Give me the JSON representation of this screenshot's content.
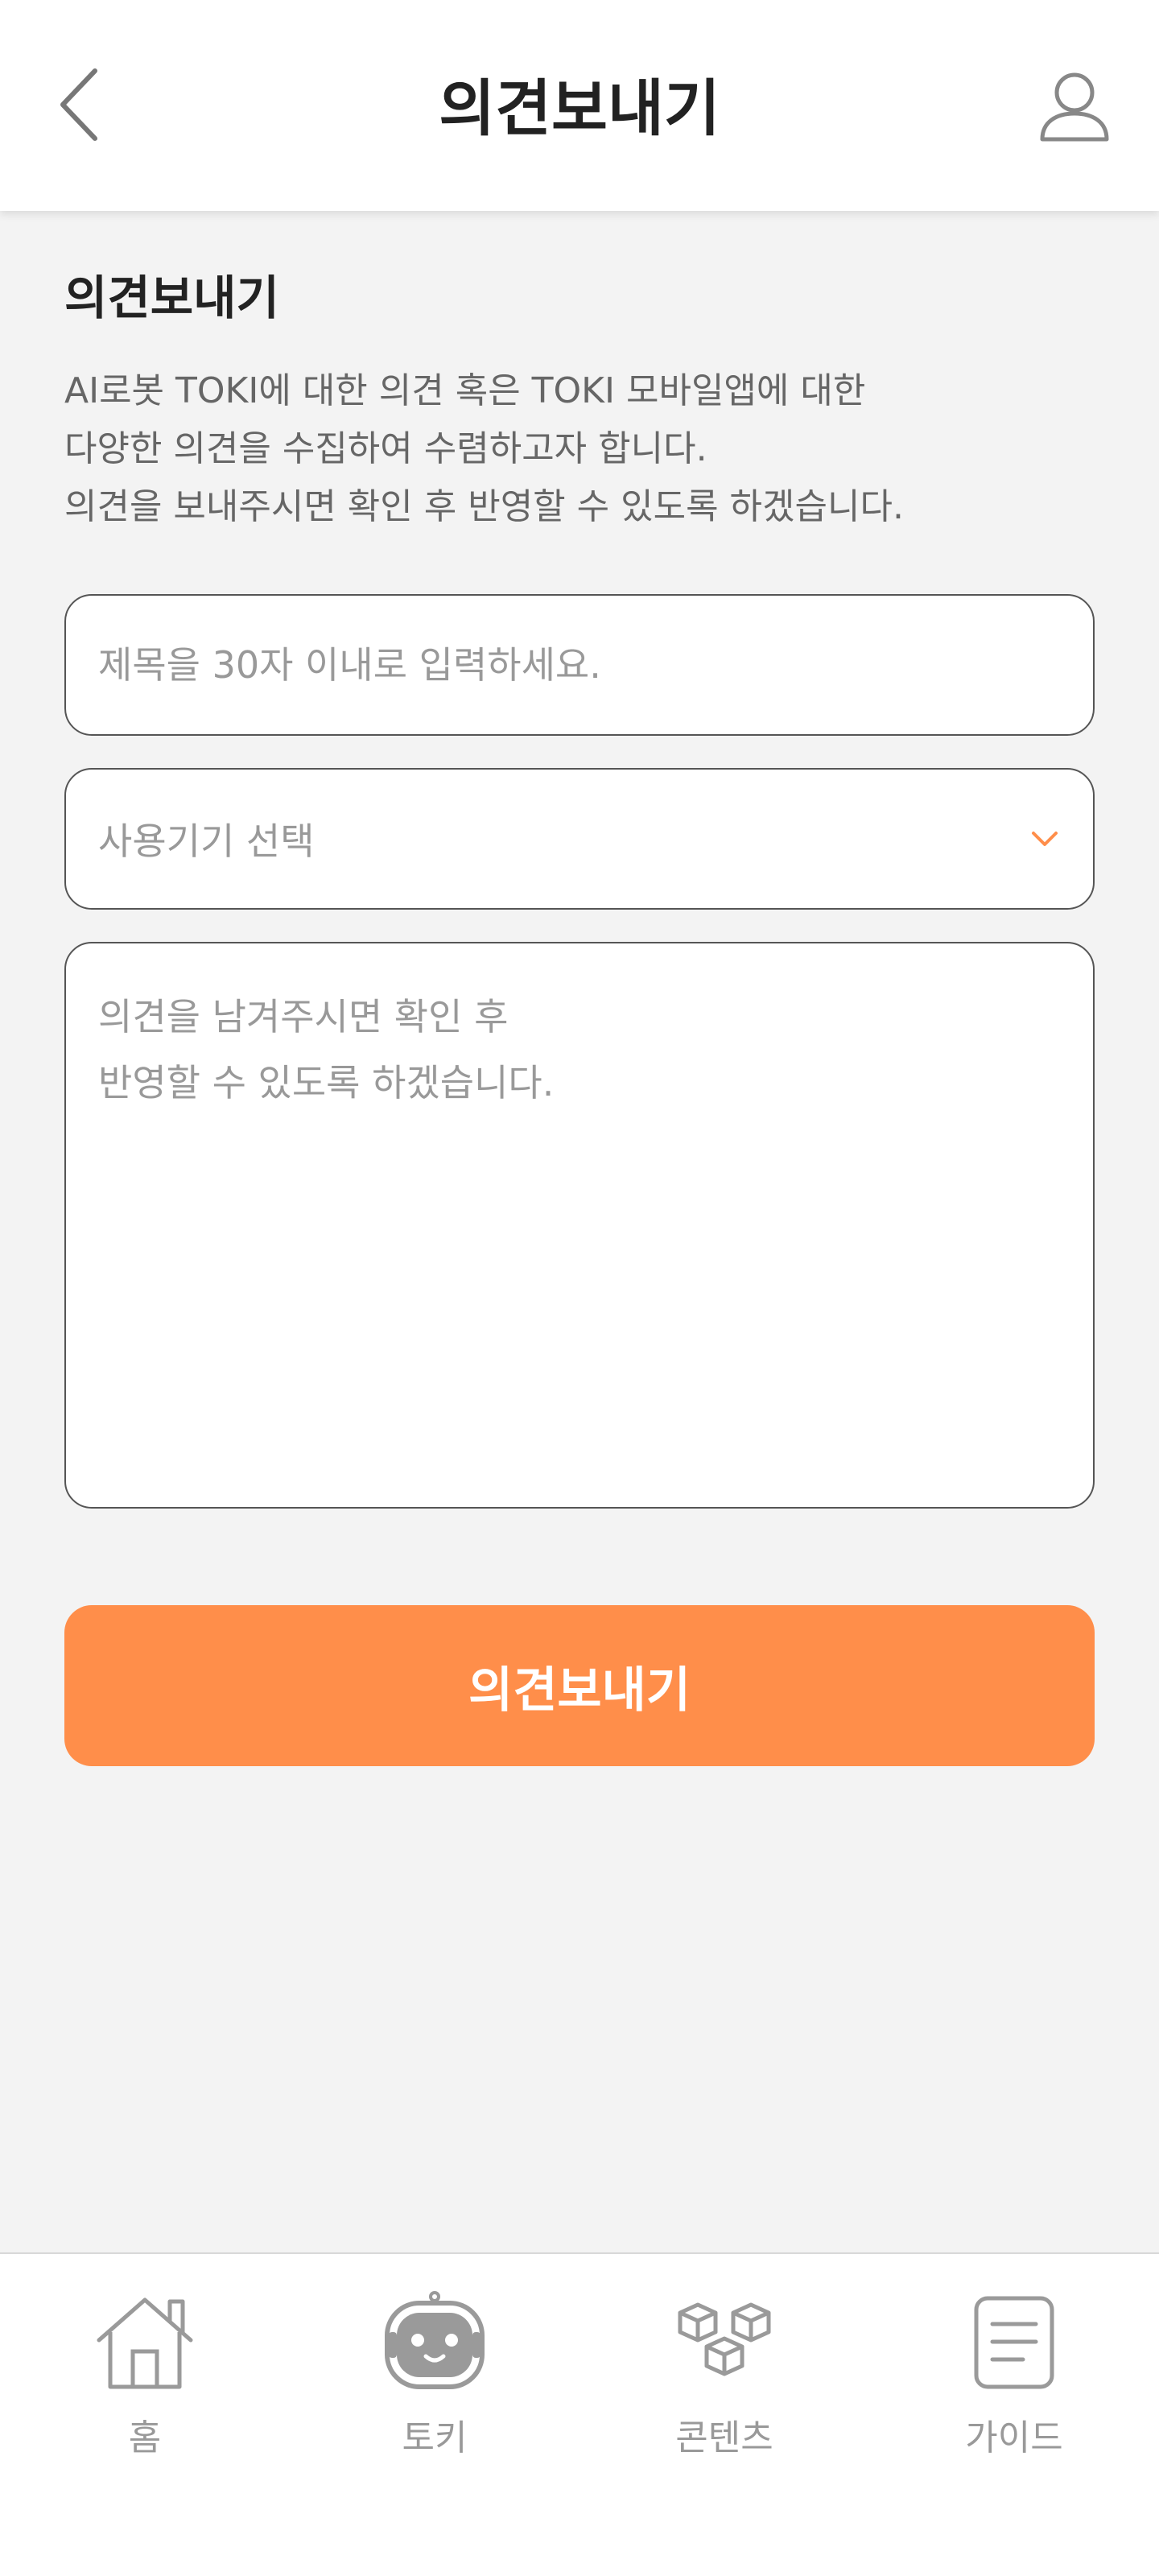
{
  "header": {
    "title": "의견보내기",
    "back_icon": "chevron-left-icon",
    "profile_icon": "user-icon"
  },
  "intro": {
    "title": "의견보내기",
    "lines": [
      "AI로봇 TOKI에 대한 의견 혹은 TOKI 모바일앱에 대한",
      "다양한 의견을 수집하여 수렴하고자 합니다.",
      "의견을 보내주시면 확인 후 반영할 수 있도록 하겠습니다."
    ]
  },
  "form": {
    "title_placeholder": "제목을 30자 이내로 입력하세요.",
    "device_placeholder": "사용기기 선택",
    "content_placeholder": "의견을 남겨주시면 확인 후\n반영할 수 있도록 하겠습니다.",
    "submit_label": "의견보내기"
  },
  "bottom_nav": {
    "items": [
      {
        "label": "홈",
        "icon": "home-icon"
      },
      {
        "label": "토키",
        "icon": "robot-face-icon"
      },
      {
        "label": "콘텐츠",
        "icon": "cubes-icon"
      },
      {
        "label": "가이드",
        "icon": "document-icon"
      }
    ]
  },
  "colors": {
    "accent": "#ff8e4a",
    "background": "#f3f3f3",
    "border": "#555555",
    "placeholder": "#999999",
    "nav_icon": "#9a9a9a"
  }
}
